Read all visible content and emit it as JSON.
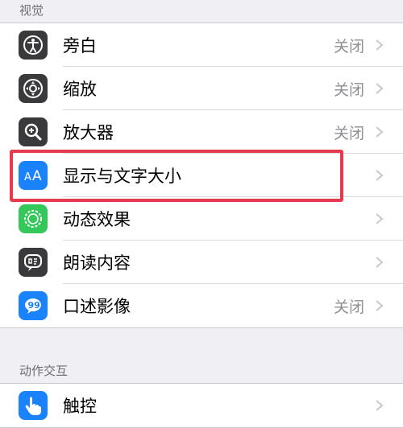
{
  "sections": [
    {
      "header": "视觉",
      "items": [
        {
          "label": "旁白",
          "value": "关闭",
          "icon": "voiceover-icon",
          "color": "#3a3a3c"
        },
        {
          "label": "缩放",
          "value": "关闭",
          "icon": "zoom-icon",
          "color": "#3a3a3c"
        },
        {
          "label": "放大器",
          "value": "关闭",
          "icon": "magnifier-icon",
          "color": "#3a3a3c"
        },
        {
          "label": "显示与文字大小",
          "value": "",
          "icon": "text-size-icon",
          "color": "#1a82fb"
        },
        {
          "label": "动态效果",
          "value": "",
          "icon": "motion-icon",
          "color": "#34c759"
        },
        {
          "label": "朗读内容",
          "value": "",
          "icon": "speech-icon",
          "color": "#3a3a3c"
        },
        {
          "label": "口述影像",
          "value": "关闭",
          "icon": "audio-description-icon",
          "color": "#1a82fb"
        }
      ]
    },
    {
      "header": "动作交互",
      "items": [
        {
          "label": "触控",
          "value": "",
          "icon": "touch-icon",
          "color": "#1a82fb"
        }
      ]
    }
  ],
  "highlight_color": "#e63a4f"
}
